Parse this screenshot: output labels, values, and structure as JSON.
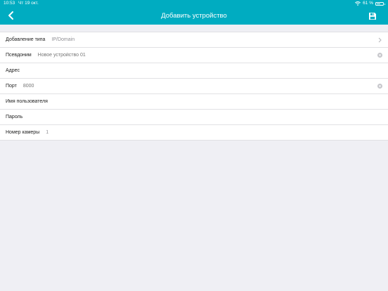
{
  "statusbar": {
    "time": "10:53",
    "date": "Чт 19 окт.",
    "battery": "61 %",
    "battery_level": 0.61
  },
  "header": {
    "title": "Добавить устройство",
    "background": "#00acc1"
  },
  "form": {
    "rows": [
      {
        "label": "Добавление типа",
        "value": "IP/Domain"
      },
      {
        "label": "Псевдоним",
        "placeholder": "Новое устройство 01"
      },
      {
        "label": "Адрес",
        "value": ""
      },
      {
        "label": "Порт",
        "placeholder": "8000"
      },
      {
        "label": "Имя пользователя",
        "value": ""
      },
      {
        "label": "Пароль",
        "value": ""
      },
      {
        "label": "Номер камеры",
        "value": "1"
      }
    ]
  },
  "icons": {
    "back": "chevron-left-icon",
    "save": "floppy-disk-icon",
    "disclosure": "chevron-right-icon",
    "clear": "clear-circle-icon"
  }
}
